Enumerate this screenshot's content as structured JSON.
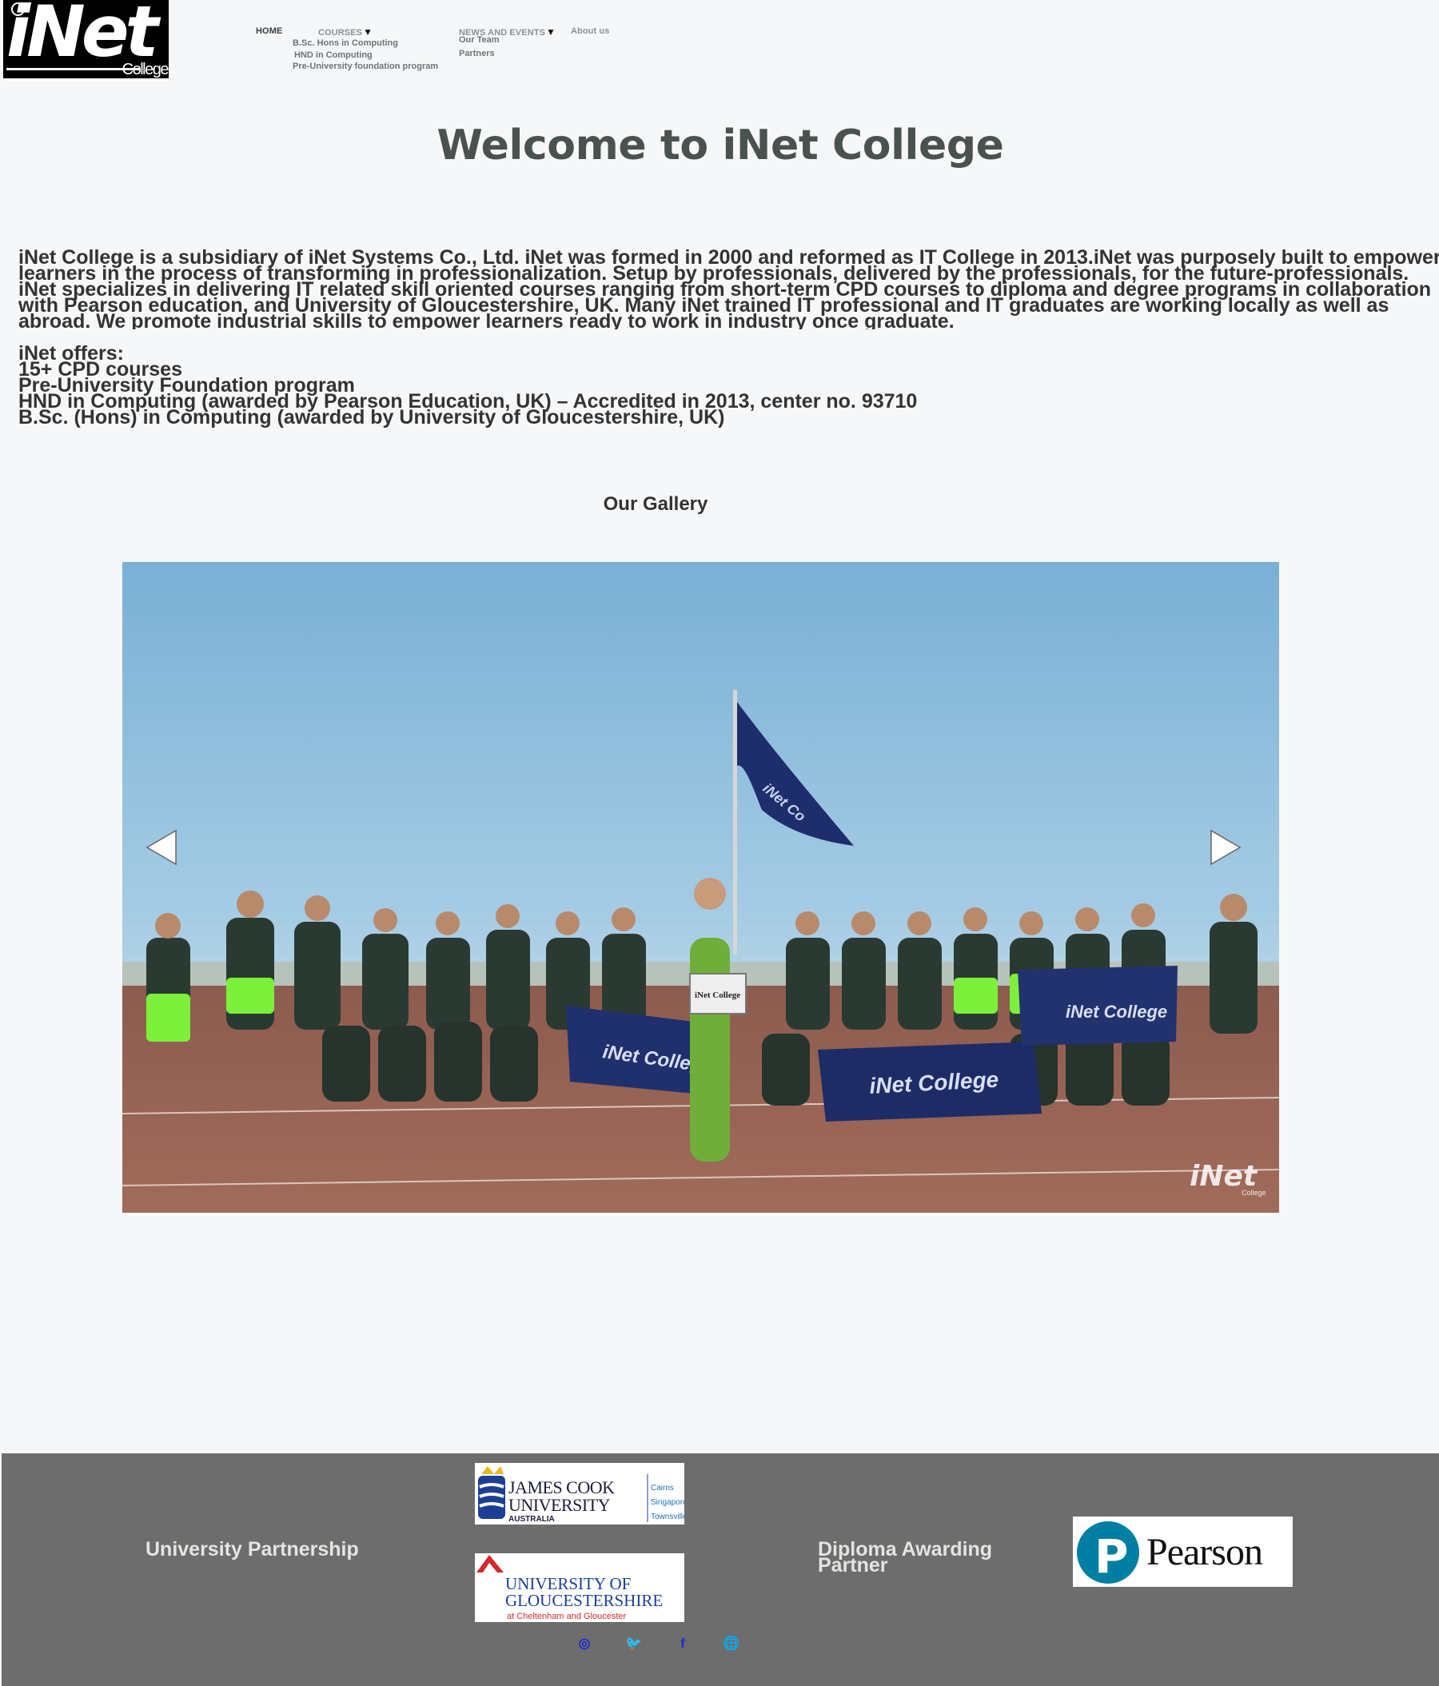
{
  "brand": {
    "logo_text": "iNet",
    "logo_sub": "College"
  },
  "nav": {
    "home": "HOME",
    "courses": "COURSES",
    "news_events": "NEWS AND EVENTS",
    "about": "About us",
    "caret": "▼",
    "courses_items": [
      "B.Sc. Hons in Computing",
      "HND in Computing",
      "Pre-University foundation program"
    ],
    "news_items": [
      "Our Team",
      "Partners"
    ]
  },
  "main": {
    "title": "Welcome to iNet College",
    "about_lines": [
      "iNet College is a subsidiary of iNet Systems Co., Ltd. iNet was formed in 2000 and reformed as IT College in 2013.iNet was purposely built to empower",
      "learners in the process of transforming in professionalization. Setup by professionals, delivered by the professionals, for the future-professionals.",
      "iNet specializes in delivering IT related skill oriented courses ranging from short-term CPD courses to diploma and degree programs in collaboration",
      "with Pearson education, and University of Gloucestershire, UK. Many iNet trained IT professional and IT graduates are working locally as well as",
      "abroad. We promote industrial skills to empower learners ready to work in industry once graduate."
    ],
    "offers_heading": "iNet offers:",
    "offers": [
      "15+ CPD courses",
      "Pre-University Foundation program",
      "HND in Computing (awarded by Pearson Education, UK) – Accredited in 2013, center no. 93710",
      "B.Sc. (Hons) in Computing (awarded by University of Gloucestershire, UK)"
    ],
    "gallery_title": "Our Gallery"
  },
  "gallery": {
    "photo_description": "iNet College football team group photo with flag and banners",
    "flag_text": "iNet Co",
    "sign_text": "iNet College",
    "banner_texts": [
      "iNet College",
      "iNet College",
      "iNet College"
    ],
    "watermark": "iNet",
    "watermark_sub": "College",
    "prev_label": "◀",
    "next_label": "▶"
  },
  "footer": {
    "university_heading": "University Partnership",
    "diploma_heading_lines": [
      "Diploma Awarding",
      "Partner"
    ],
    "jcu": {
      "line1": "JAMES COOK",
      "line2": "UNIVERSITY",
      "line3": "AUSTRALIA",
      "campuses": [
        "Cairns",
        "Singapore",
        "Townsville"
      ]
    },
    "glos": {
      "line1": "UNIVERSITY OF",
      "line2": "GLOUCESTERSHIRE",
      "line3": "at Cheltenham and Gloucester"
    },
    "pearson": {
      "mark": "P",
      "name": "Pearson"
    },
    "social": [
      {
        "name": "instagram",
        "glyph": "◎"
      },
      {
        "name": "twitter",
        "glyph": "🐦"
      },
      {
        "name": "facebook",
        "glyph": "f"
      },
      {
        "name": "website",
        "glyph": "🌐"
      }
    ],
    "colors": {
      "background": "#6d6d6d",
      "heading": "#e3e5e1",
      "icon": "#1b2bd6",
      "jcu_blue": "#1c3f95",
      "glos_red": "#d5282f",
      "pearson_teal": "#007fa3"
    }
  }
}
